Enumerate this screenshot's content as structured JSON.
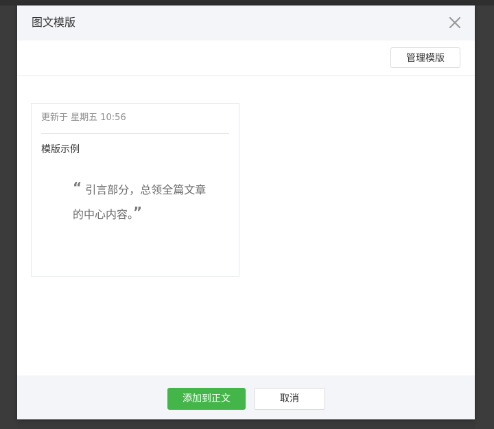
{
  "dialog": {
    "title": "图文模版",
    "close_icon": "close-icon"
  },
  "toolbar": {
    "manage_label": "管理模版"
  },
  "template_card": {
    "updated_text": "更新于 星期五 10:56",
    "title": "模版示例",
    "quote_open": "“",
    "quote_line1": "引言部分，总领全篇文章",
    "quote_line2": "的中心内容。",
    "quote_close": "”"
  },
  "footer": {
    "add_label": "添加到正文",
    "cancel_label": "取消"
  },
  "colors": {
    "primary": "#44b549",
    "header_bg": "#f4f5f9",
    "border": "#e4e8eb",
    "backdrop": "#3a3a3a"
  }
}
